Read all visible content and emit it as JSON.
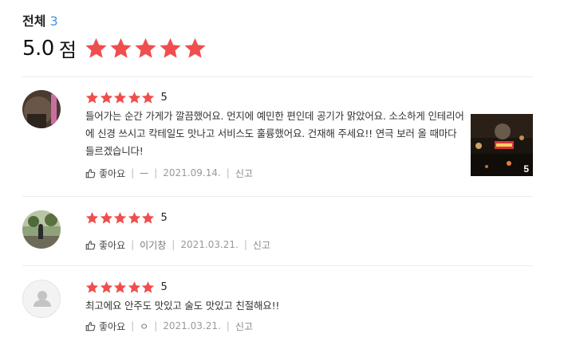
{
  "header": {
    "title": "전체",
    "count": "3"
  },
  "summary": {
    "rating": "5.0",
    "unit": "점",
    "stars": 5
  },
  "colors": {
    "star": "#f04e4e",
    "accent": "#4a90e2"
  },
  "reviews": [
    {
      "score": "5",
      "text": "들어가는 순간 가게가 깔끔했어요. 먼지에 예민한 편인데 공기가 맑았어요. 소소하게 인테리어에 신경 쓰시고 칵테일도 맛나고 서비스도 훌륭했어요. 건재해 주세요!! 연극 보러 올 때마다 들르겠습니다!",
      "like": "좋아요",
      "author": "ㅡ",
      "date": "2021.09.14.",
      "report": "신고",
      "photo_count": "5"
    },
    {
      "score": "5",
      "text": "",
      "like": "좋아요",
      "author": "이기창",
      "date": "2021.03.21.",
      "report": "신고"
    },
    {
      "score": "5",
      "text": "최고에요 안주도 맛있고 술도 맛있고 친절해요!!",
      "like": "좋아요",
      "author": "ㅇ",
      "date": "2021.03.21.",
      "report": "신고"
    }
  ]
}
